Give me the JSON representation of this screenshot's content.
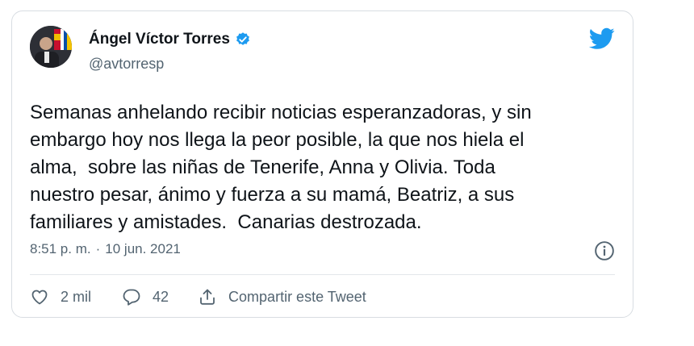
{
  "tweet": {
    "author_name": "Ángel Víctor Torres",
    "author_handle": "@avtorresp",
    "text": "Semanas anhelando recibir noticias esperanzadoras, y sin\nembargo hoy nos llega la peor posible, la que nos hiela el\nalma,  sobre las niñas de Tenerife, Anna y Olivia. Toda\nnuestro pesar, ánimo y fuerza a su mamá, Beatriz, a sus\nfamiliares y amistades.  Canarias destrozada.",
    "time": "8:51 p. m.",
    "separator": "·",
    "date": "10 jun. 2021"
  },
  "actions": {
    "likes": "2 mil",
    "replies": "42",
    "share_label": "Compartir este Tweet"
  },
  "icons": {
    "verified": "verified-badge-icon",
    "brand": "twitter-bird-icon",
    "info": "info-icon",
    "like": "heart-icon",
    "reply": "reply-bubble-icon",
    "share": "share-icon"
  },
  "colors": {
    "brand": "#1d9bf0",
    "text": "#0f1419",
    "secondary": "#536471",
    "border": "#d8dde2"
  }
}
